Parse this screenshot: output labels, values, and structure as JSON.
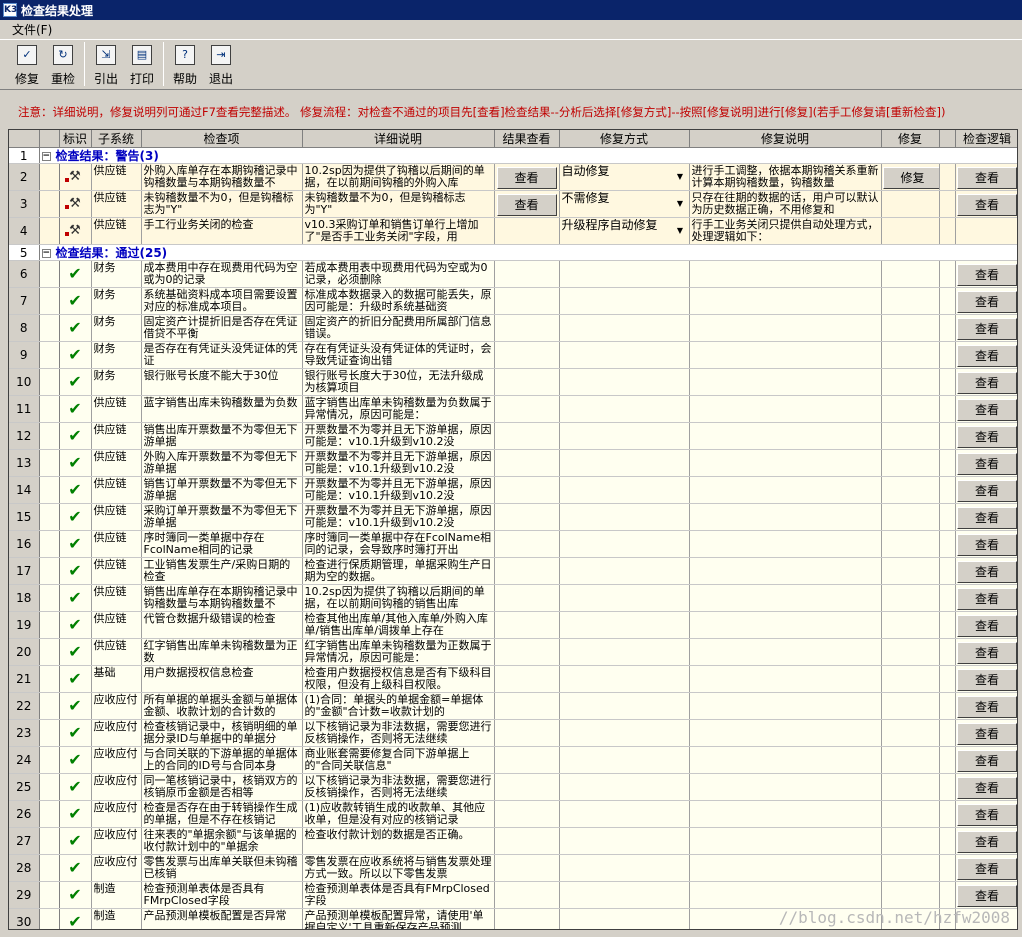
{
  "window": {
    "title": "检查结果处理",
    "app_icon": "K3"
  },
  "menu": {
    "file": "文件(F)"
  },
  "toolbar": [
    {
      "label": "修复",
      "icon": "check-doc-icon"
    },
    {
      "label": "重检",
      "icon": "refresh-icon"
    },
    {
      "label": "引出",
      "icon": "export-icon"
    },
    {
      "label": "打印",
      "icon": "print-icon"
    },
    {
      "label": "帮助",
      "icon": "help-icon"
    },
    {
      "label": "退出",
      "icon": "exit-icon"
    }
  ],
  "notice": "注意：详细说明，修复说明列可通过F7查看完整描述。  修复流程：对检查不通过的项目先[查看]检查结果--分析后选择[修复方式]--按照[修复说明]进行[修复](若手工修复请[重新检查])",
  "columns": {
    "mark": "标识",
    "subsystem": "子系统",
    "item": "检查项",
    "detail": "详细说明",
    "view": "结果查看",
    "method": "修复方式",
    "fixdesc": "修复说明",
    "fix": "修复",
    "logic": "检查逻辑"
  },
  "groups": {
    "warn": {
      "row": "1",
      "title": "检查结果：警告(3)",
      "expander": "−"
    },
    "pass": {
      "row": "5",
      "title": "检查结果：通过(25)",
      "expander": "−"
    }
  },
  "warn_rows": [
    {
      "n": "2",
      "sub": "供应链",
      "item": "外购入库单存在本期钩稽记录中钩稽数量与本期钩稽数量不",
      "detail": "10.2sp因为提供了钩稽以后期间的单据，在以前期间钩稽的外购入库",
      "view": "查看",
      "method": "自动修复",
      "fixdesc": "进行手工调整，依据本期钩稽关系重新计算本期钩稽数量，钩稽数量",
      "fix": "修复",
      "logic": "查看"
    },
    {
      "n": "3",
      "sub": "供应链",
      "item": "未钩稽数量不为0，但是钩稽标志为\"Y\"",
      "detail": "未钩稽数量不为0，但是钩稽标志为\"Y\"",
      "view": "查看",
      "method": "不需修复",
      "fixdesc": "只存在往期的数据的话，用户可以默认为历史数据正确，不用修复和",
      "fix": "",
      "logic": "查看"
    },
    {
      "n": "4",
      "sub": "供应链",
      "item": "手工行业务关闭的检查",
      "detail": "v10.3采购订单和销售订单行上增加了\"是否手工业务关闭\"字段，用",
      "view": "",
      "method": "升级程序自动修复",
      "fixdesc": "行手工业务关闭只提供自动处理方式，处理逻辑如下：",
      "fix": "",
      "logic": ""
    }
  ],
  "pass_rows": [
    {
      "n": "6",
      "sub": "财务",
      "item": "成本费用中存在现费用代码为空或为0的记录",
      "detail": "若成本费用表中现费用代码为空或为0记录，必须删除",
      "logic": "查看"
    },
    {
      "n": "7",
      "sub": "财务",
      "item": "系统基础资料成本项目需要设置对应的标准成本项目。",
      "detail": "标准成本数据录入的数据可能丢失，原因可能是：升级时系统基础资",
      "logic": "查看"
    },
    {
      "n": "8",
      "sub": "财务",
      "item": "固定资产计提折旧是否存在凭证借贷不平衡",
      "detail": "固定资产的折旧分配费用所属部门信息错误。",
      "logic": "查看"
    },
    {
      "n": "9",
      "sub": "财务",
      "item": "是否存在有凭证头没凭证体的凭证",
      "detail": "存在有凭证头没有凭证体的凭证时，会导致凭证查询出错",
      "logic": "查看"
    },
    {
      "n": "10",
      "sub": "财务",
      "item": "银行账号长度不能大于30位",
      "detail": "银行账号长度大于30位，无法升级成为核算项目",
      "logic": "查看"
    },
    {
      "n": "11",
      "sub": "供应链",
      "item": "蓝字销售出库未钩稽数量为负数",
      "detail": "蓝字销售出库单未钩稽数量为负数属于异常情况，原因可能是：",
      "logic": "查看"
    },
    {
      "n": "12",
      "sub": "供应链",
      "item": "销售出库开票数量不为零但无下游单据",
      "detail": "开票数量不为零并且无下游单据，原因可能是：v10.1升级到v10.2没",
      "logic": "查看"
    },
    {
      "n": "13",
      "sub": "供应链",
      "item": "外购入库开票数量不为零但无下游单据",
      "detail": "开票数量不为零并且无下游单据，原因可能是：v10.1升级到v10.2没",
      "logic": "查看"
    },
    {
      "n": "14",
      "sub": "供应链",
      "item": "销售订单开票数量不为零但无下游单据",
      "detail": "开票数量不为零并且无下游单据，原因可能是：v10.1升级到v10.2没",
      "logic": "查看"
    },
    {
      "n": "15",
      "sub": "供应链",
      "item": "采购订单开票数量不为零但无下游单据",
      "detail": "开票数量不为零并且无下游单据，原因可能是：v10.1升级到v10.2没",
      "logic": "查看"
    },
    {
      "n": "16",
      "sub": "供应链",
      "item": "序时簿同一类单据中存在FcolName相同的记录",
      "detail": "序时簿同一类单据中存在FcolName相同的记录，会导致序时簿打开出",
      "logic": "查看"
    },
    {
      "n": "17",
      "sub": "供应链",
      "item": "工业销售发票生产/采购日期的检查",
      "detail": "检查进行保质期管理，单据采购生产日期为空的数据。",
      "logic": "查看"
    },
    {
      "n": "18",
      "sub": "供应链",
      "item": "销售出库单存在本期钩稽记录中钩稽数量与本期钩稽数量不",
      "detail": "10.2sp因为提供了钩稽以后期间的单据，在以前期间钩稽的销售出库",
      "logic": "查看"
    },
    {
      "n": "19",
      "sub": "供应链",
      "item": "代管仓数据升级错误的检查",
      "detail": "检查其他出库单/其他入库单/外购入库单/销售出库单/调拨单上存在",
      "logic": "查看"
    },
    {
      "n": "20",
      "sub": "供应链",
      "item": "红字销售出库单未钩稽数量为正数",
      "detail": "红字销售出库单未钩稽数量为正数属于异常情况，原因可能是：",
      "logic": "查看"
    },
    {
      "n": "21",
      "sub": "基础",
      "item": "用户数据授权信息检查",
      "detail": "检查用户数据授权信息是否有下级科目权限，但没有上级科目权限。",
      "logic": "查看"
    },
    {
      "n": "22",
      "sub": "应收应付",
      "item": "所有单据的单据头金额与单据体金额、收款计划的合计数的",
      "detail": "(1)合同：单据头的单据金额=单据体的\"金额\"合计数=收款计划的",
      "logic": "查看"
    },
    {
      "n": "23",
      "sub": "应收应付",
      "item": "检查核销记录中，核销明细的单据分录ID与单据中的单据分",
      "detail": "以下核销记录为非法数据，需要您进行反核销操作，否则将无法继续",
      "logic": "查看"
    },
    {
      "n": "24",
      "sub": "应收应付",
      "item": "与合同关联的下游单据的单据体上的合同的ID号与合同本身",
      "detail": "商业账套需要修复合同下游单据上的\"合同关联信息\"",
      "logic": "查看"
    },
    {
      "n": "25",
      "sub": "应收应付",
      "item": "同一笔核销记录中，核销双方的核销原币金额是否相等",
      "detail": "以下核销记录为非法数据，需要您进行反核销操作，否则将无法继续",
      "logic": "查看"
    },
    {
      "n": "26",
      "sub": "应收应付",
      "item": "检查是否存在由于转销操作生成的单据，但是不存在核销记",
      "detail": "(1)应收款转销生成的收款单、其他应收单，但是没有对应的核销记录",
      "logic": "查看"
    },
    {
      "n": "27",
      "sub": "应收应付",
      "item": "往来表的\"单据余额\"与该单据的收付款计划中的\"单据余",
      "detail": "检查收付款计划的数据是否正确。",
      "logic": "查看"
    },
    {
      "n": "28",
      "sub": "应收应付",
      "item": "零售发票与出库单关联但未钩稽已核销",
      "detail": "零售发票在应收系统将与销售发票处理方式一致。所以以下零售发票",
      "logic": "查看"
    },
    {
      "n": "29",
      "sub": "制造",
      "item": "检查预测单表体是否具有FMrpClosed字段",
      "detail": "检查预测单表体是否具有FMrpClosed字段",
      "logic": "查看"
    },
    {
      "n": "30",
      "sub": "制造",
      "item": "产品预测单模板配置是否异常",
      "detail": "产品预测单模板配置异常，请使用'单据自定义'工具重新保存产品预测",
      "logic": ""
    }
  ],
  "watermark": "//blog.csdn.net/hzfw2008"
}
